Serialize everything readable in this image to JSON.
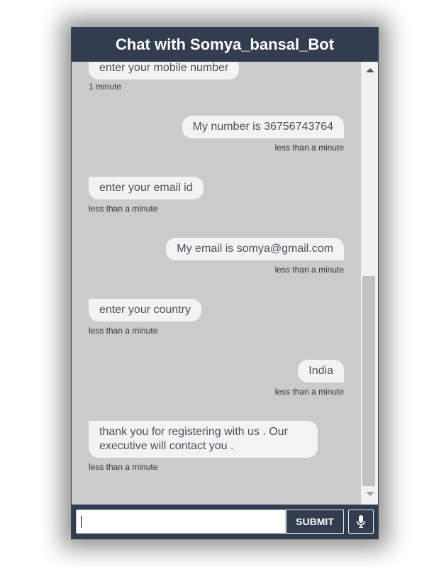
{
  "header": {
    "title": "Chat with Somya_bansal_Bot"
  },
  "messages": [
    {
      "sender": "bot",
      "text": "enter your mobile number",
      "time": "1 minute"
    },
    {
      "sender": "user",
      "text": "My number is 36756743764",
      "time": "less than a minute"
    },
    {
      "sender": "bot",
      "text": "enter your email id",
      "time": "less than a minute"
    },
    {
      "sender": "user",
      "text": "My email is somya@gmail.com",
      "time": "less than a minute"
    },
    {
      "sender": "bot",
      "text": "enter your country",
      "time": "less than a minute"
    },
    {
      "sender": "user",
      "text": "India",
      "time": "less than a minute"
    },
    {
      "sender": "bot",
      "text": "thank you for registering with us . Our executive will contact you .",
      "time": "less than a minute"
    }
  ],
  "input": {
    "value": "",
    "placeholder": ""
  },
  "submit_label": "SUBMIT",
  "icons": {
    "mic": "microphone-icon",
    "scroll_up": "scroll-up-arrow-icon",
    "scroll_down": "scroll-down-arrow-icon"
  },
  "colors": {
    "header_bg": "#323d4f",
    "chat_bg": "#cbcbcb",
    "bubble_bg": "#f3f3f3",
    "text": "#4b4f57"
  }
}
